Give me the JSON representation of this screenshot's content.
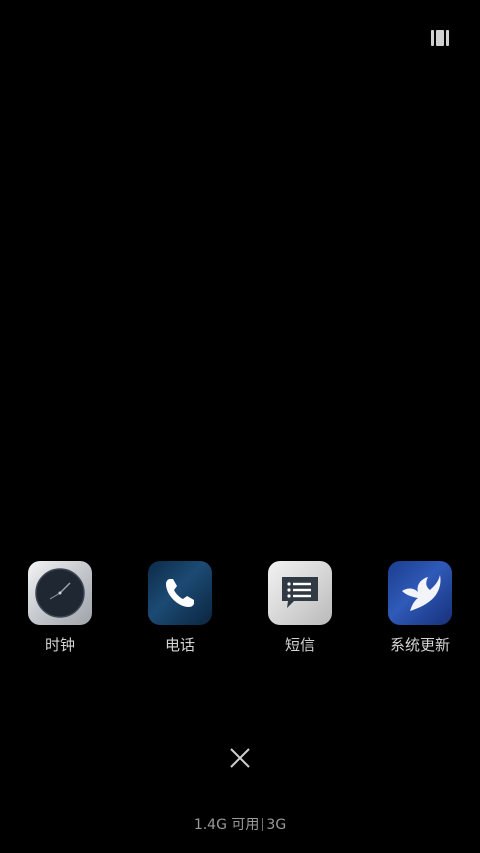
{
  "apps": [
    {
      "label": "时钟",
      "icon": "clock-icon"
    },
    {
      "label": "电话",
      "icon": "phone-icon"
    },
    {
      "label": "短信",
      "icon": "message-icon"
    },
    {
      "label": "系统更新",
      "icon": "system-update-icon"
    }
  ],
  "memory": {
    "available": "1.4G 可用",
    "total": "3G"
  },
  "controls": {
    "close_icon": "close-icon",
    "view_toggle_icon": "recents-view-toggle-icon"
  },
  "colors": {
    "background": "#000000",
    "label": "#d4d4d4",
    "status": "#9a9a9a"
  }
}
